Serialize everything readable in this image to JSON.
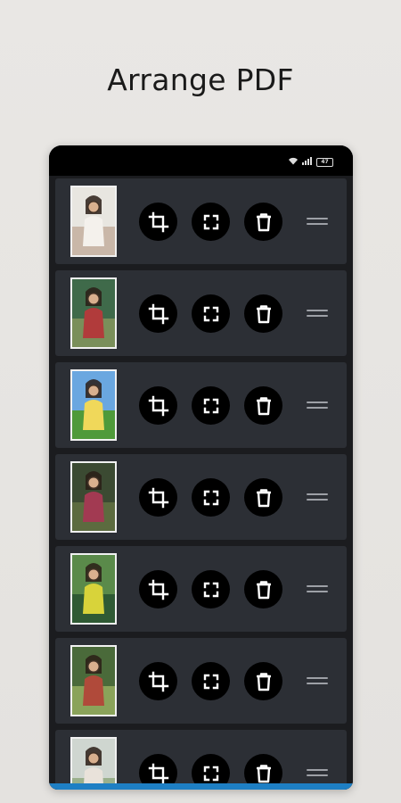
{
  "headline": "Arrange PDF",
  "status_bar": {
    "network": "₿𝐇",
    "signal_label": "4l",
    "battery": "47"
  },
  "pages": [
    {
      "thumb_colors": [
        "#e8e6e0",
        "#c9b7a8",
        "#f4f1ec"
      ]
    },
    {
      "thumb_colors": [
        "#3f6a4a",
        "#7a8f5a",
        "#b13b3b"
      ]
    },
    {
      "thumb_colors": [
        "#6aa7e0",
        "#4f9a3a",
        "#f0d85a"
      ]
    },
    {
      "thumb_colors": [
        "#3b4a32",
        "#5c6b3f",
        "#a23a52"
      ]
    },
    {
      "thumb_colors": [
        "#5a8a4a",
        "#2f5a34",
        "#d8d33a"
      ]
    },
    {
      "thumb_colors": [
        "#4a6a3a",
        "#8aa35a",
        "#b04a3a"
      ]
    },
    {
      "thumb_colors": [
        "#cfd6d0",
        "#9ab08c",
        "#e9e2da"
      ]
    }
  ],
  "icons": {
    "crop": "crop-icon",
    "fit": "fullscreen-icon",
    "delete": "trash-icon",
    "drag": "drag-handle-icon"
  },
  "colors": {
    "row_bg": "#2c2f35",
    "button_bg": "#000000",
    "accent_bar": "#1e7fc4"
  }
}
